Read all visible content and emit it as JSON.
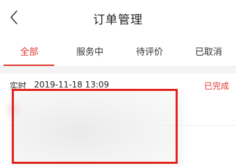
{
  "header": {
    "title": "订单管理",
    "back_icon": "chevron-left-icon"
  },
  "tabs": [
    {
      "label": "全部",
      "active": true
    },
    {
      "label": "服务中",
      "active": false
    },
    {
      "label": "待评价",
      "active": false
    },
    {
      "label": "已取消",
      "active": false
    }
  ],
  "order": {
    "type": "实时",
    "time": "2019-11-18 13:09",
    "status": "已完成"
  },
  "colors": {
    "accent": "#e0372d",
    "highlight_border": "#e2231a",
    "text": "#222222",
    "divider": "#eeeeee"
  }
}
